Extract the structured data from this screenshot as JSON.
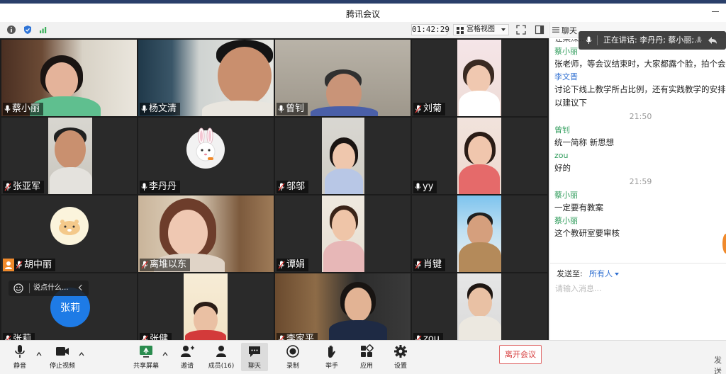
{
  "window": {
    "title": "腾讯会议"
  },
  "toolbar": {
    "timer": "01:42:29",
    "view_mode": "宫格视图"
  },
  "speaking_banner": "正在讲话: 李丹丹; 蔡小丽;...",
  "participants": [
    {
      "name": "蔡小丽",
      "mic": "on"
    },
    {
      "name": "杨文清",
      "mic": "on"
    },
    {
      "name": "曾钊",
      "mic": "on"
    },
    {
      "name": "刘菊",
      "mic": "muted"
    },
    {
      "name": "张亚军",
      "mic": "muted"
    },
    {
      "name": "李丹丹",
      "mic": "on"
    },
    {
      "name": "邬邬",
      "mic": "muted"
    },
    {
      "name": "yy",
      "mic": "on"
    },
    {
      "name": "胡中丽",
      "mic": "muted"
    },
    {
      "name": "离堆以东",
      "mic": "muted"
    },
    {
      "name": "谭娟",
      "mic": "muted"
    },
    {
      "name": "肖键",
      "mic": "muted"
    },
    {
      "name": "张莉",
      "mic": "muted",
      "avatar_text": "张莉"
    },
    {
      "name": "张健",
      "mic": "muted"
    },
    {
      "name": "李家平",
      "mic": "muted"
    },
    {
      "name": "zou",
      "mic": "muted"
    }
  ],
  "emoji_bubble": {
    "placeholder": "说点什么..."
  },
  "chat": {
    "header": "聊天",
    "messages": [
      {
        "kind": "text",
        "text": "让某深..."
      },
      {
        "kind": "sender",
        "text": "蔡小丽"
      },
      {
        "kind": "text",
        "text": "张老师，等会议结束时，大家都露个脸，拍个会议"
      },
      {
        "kind": "sender",
        "text": "李文晋",
        "color": "blue"
      },
      {
        "kind": "text",
        "text": "讨论下线上教学所占比例，还有实践教学的安排，"
      },
      {
        "kind": "text",
        "text": "以建议下"
      },
      {
        "kind": "time",
        "text": "21:50"
      },
      {
        "kind": "sender",
        "text": "曾钊"
      },
      {
        "kind": "text",
        "text": "统一简称  新思想"
      },
      {
        "kind": "sender",
        "text": "zou"
      },
      {
        "kind": "text",
        "text": "好的"
      },
      {
        "kind": "time",
        "text": "21:59"
      },
      {
        "kind": "sender",
        "text": "蔡小丽"
      },
      {
        "kind": "text",
        "text": "一定要有教案"
      },
      {
        "kind": "sender",
        "text": "蔡小丽"
      },
      {
        "kind": "text",
        "text": "这个教研室要审核"
      }
    ],
    "send_to_label": "发送至:",
    "send_to_value": "所有人",
    "input_placeholder": "请输入消息...",
    "send_button_partial": "发送"
  },
  "bottom_bar": {
    "mute": "静音",
    "stop_video": "停止视频",
    "share_screen": "共享屏幕",
    "invite": "邀请",
    "members": "成员(16)",
    "chat": "聊天",
    "record": "录制",
    "raise_hand": "举手",
    "apps": "应用",
    "settings": "设置",
    "leave": "离开会议"
  },
  "colors": {
    "active_speaker_border": "#3dbd6e",
    "sender_green": "#2f9c5b",
    "leave_red": "#d63b3b",
    "title_strip": "#2a3f6a"
  }
}
